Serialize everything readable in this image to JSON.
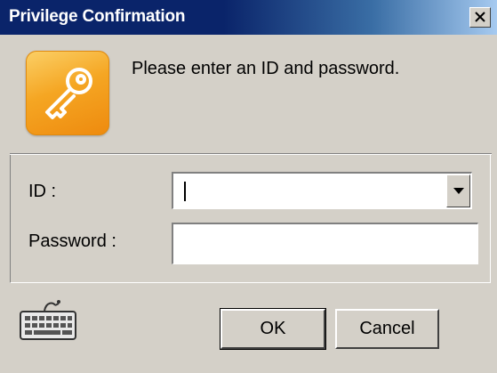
{
  "window": {
    "title": "Privilege Confirmation",
    "close_symbol": "×"
  },
  "header": {
    "icon": "key-icon",
    "message": "Please enter an ID and password."
  },
  "form": {
    "id_label": "ID :",
    "id_value": "",
    "password_label": "Password :",
    "password_value": ""
  },
  "footer": {
    "keyboard_icon": "keyboard-icon",
    "ok_label": "OK",
    "cancel_label": "Cancel"
  },
  "colors": {
    "titlebar": "#0a246a",
    "face": "#d4d0c8",
    "key_tile": "#f5a623"
  }
}
